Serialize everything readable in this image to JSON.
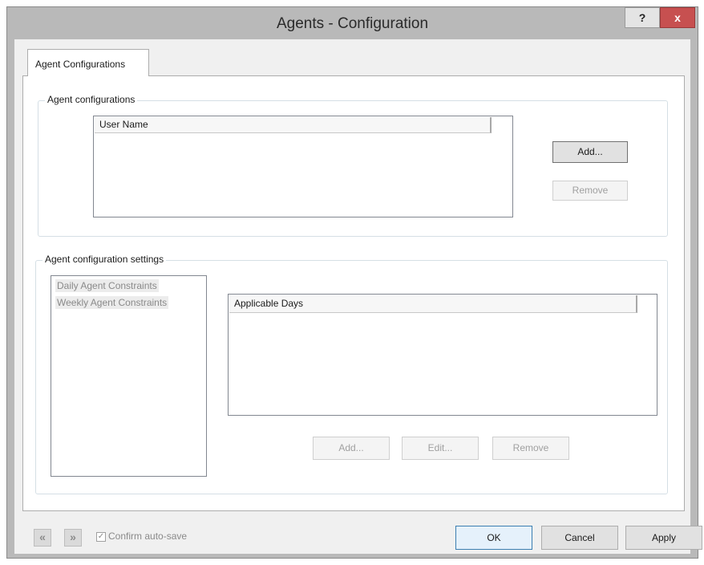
{
  "window": {
    "title": "Agents - Configuration",
    "help_label": "?",
    "close_label": "x"
  },
  "tabs": [
    {
      "label": "Agent Configurations",
      "selected": true
    }
  ],
  "agent_configurations": {
    "group_label": "Agent configurations",
    "column_header": "User Name",
    "rows": [],
    "add_label": "Add...",
    "remove_label": "Remove"
  },
  "settings": {
    "group_label": "Agent configuration settings",
    "constraints": [
      "Daily Agent Constraints",
      "Weekly Agent Constraints"
    ],
    "column_header": "Applicable Days",
    "rows": [],
    "add_label": "Add...",
    "edit_label": "Edit...",
    "remove_label": "Remove"
  },
  "footer": {
    "prev_icon": "«",
    "next_icon": "»",
    "confirm_label": "Confirm auto-save",
    "confirm_checked": true,
    "ok_label": "OK",
    "cancel_label": "Cancel",
    "apply_label": "Apply"
  },
  "colors": {
    "frame": "#b9b9b9",
    "close": "#c75050",
    "client": "#f0f0f0"
  }
}
